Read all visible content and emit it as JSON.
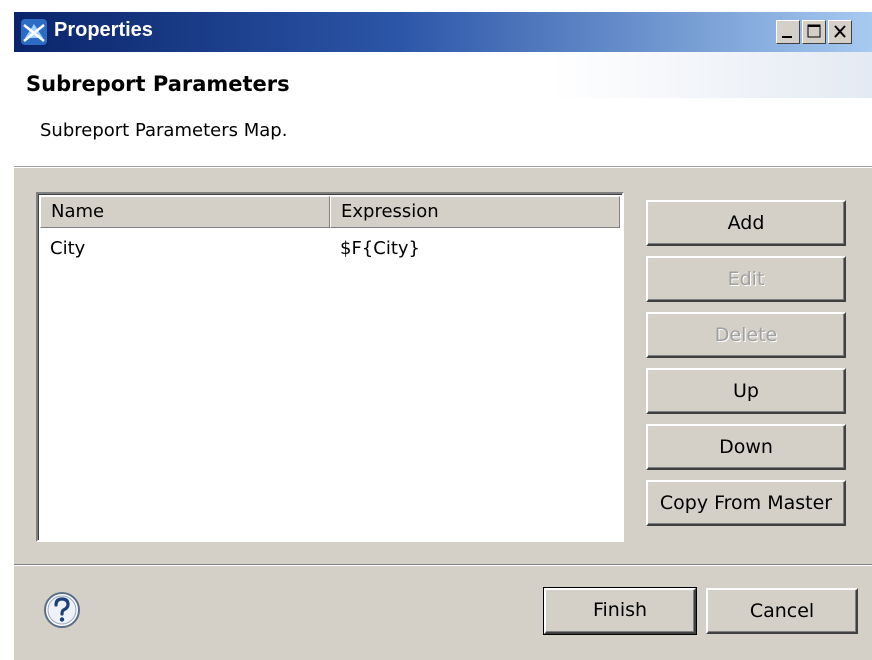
{
  "window": {
    "title": "Properties",
    "icon": "jasper-icon",
    "controls": [
      "minimize-icon",
      "maximize-icon",
      "close-icon"
    ]
  },
  "header": {
    "title": "Subreport Parameters",
    "description": "Subreport Parameters Map."
  },
  "table": {
    "columns": [
      "Name",
      "Expression"
    ],
    "rows": [
      {
        "name": "City",
        "expression": "$F{City}"
      }
    ]
  },
  "actions": {
    "add": "Add",
    "edit": "Edit",
    "delete": "Delete",
    "up": "Up",
    "down": "Down",
    "copy_from_master": "Copy From Master"
  },
  "footer": {
    "help_icon": "help-icon",
    "finish": "Finish",
    "cancel": "Cancel"
  },
  "colors": {
    "titlebar_start": "#0a246a",
    "titlebar_end": "#a6caf0",
    "dialog_face": "#d4d0c8",
    "disabled_text": "#a0a0a0"
  }
}
